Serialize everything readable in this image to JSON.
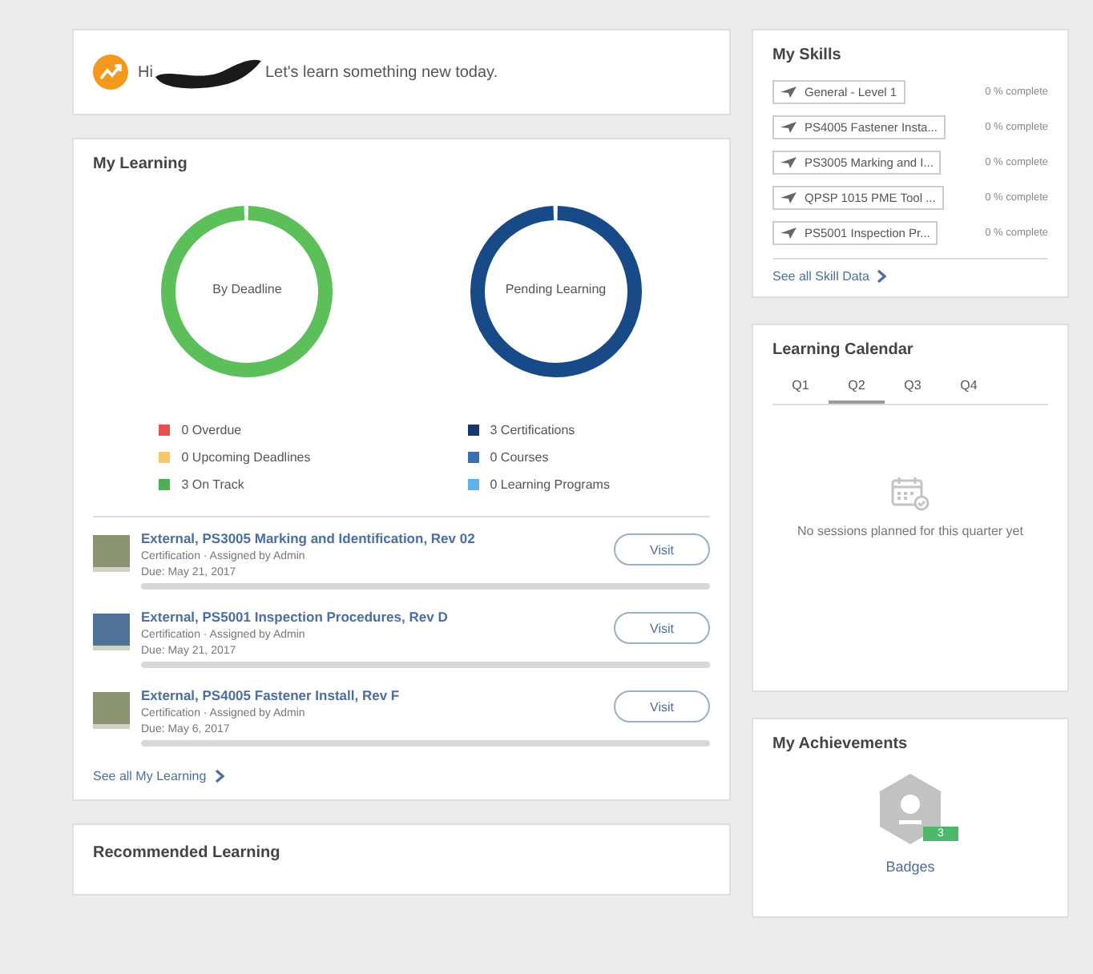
{
  "greeting": {
    "prefix": "Hi",
    "suffix": "Let's learn something new today."
  },
  "my_learning": {
    "title": "My Learning",
    "donuts": [
      {
        "label": "By Deadline",
        "color": "#5cbf5a",
        "legend": [
          {
            "text": "0 Overdue",
            "color": "#e8514f"
          },
          {
            "text": "0 Upcoming Deadlines",
            "color": "#f5c96a"
          },
          {
            "text": "3 On Track",
            "color": "#4cb050"
          }
        ]
      },
      {
        "label": "Pending Learning",
        "color": "#174a86",
        "legend": [
          {
            "text": "3 Certifications",
            "color": "#15396b"
          },
          {
            "text": "0 Courses",
            "color": "#3a70b0"
          },
          {
            "text": "0 Learning Programs",
            "color": "#5ab4e8"
          }
        ]
      }
    ],
    "items": [
      {
        "title": "External, PS3005 Marking and Identification, Rev 02",
        "meta": "Certification · Assigned by Admin",
        "due": "Due: May 21, 2017",
        "color": "#8a9470",
        "button": "Visit"
      },
      {
        "title": "External, PS5001 Inspection Procedures, Rev D",
        "meta": "Certification · Assigned by Admin",
        "due": "Due: May 21, 2017",
        "color": "#4f7396",
        "button": "Visit"
      },
      {
        "title": "External, PS4005 Fastener Install, Rev F",
        "meta": "Certification · Assigned by Admin",
        "due": "Due: May 6, 2017",
        "color": "#8a9470",
        "button": "Visit"
      }
    ],
    "see_all": "See all My Learning"
  },
  "recommended": {
    "title": "Recommended Learning"
  },
  "my_skills": {
    "title": "My Skills",
    "skills": [
      {
        "name": "General - Level 1",
        "completion": "0 % complete"
      },
      {
        "name": "PS4005 Fastener Insta...",
        "completion": "0 % complete"
      },
      {
        "name": "PS3005 Marking and I...",
        "completion": "0 % complete"
      },
      {
        "name": "QPSP 1015 PME Tool ...",
        "completion": "0 % complete"
      },
      {
        "name": "PS5001 Inspection Pr...",
        "completion": "0 % complete"
      }
    ],
    "see_all": "See all Skill Data"
  },
  "calendar": {
    "title": "Learning Calendar",
    "tabs": [
      {
        "label": "Q1",
        "selected": false
      },
      {
        "label": "Q2",
        "selected": true
      },
      {
        "label": "Q3",
        "selected": false
      },
      {
        "label": "Q4",
        "selected": false
      }
    ],
    "empty": "No sessions planned for this quarter yet"
  },
  "achievements": {
    "title": "My Achievements",
    "count": "3",
    "link": "Badges"
  }
}
